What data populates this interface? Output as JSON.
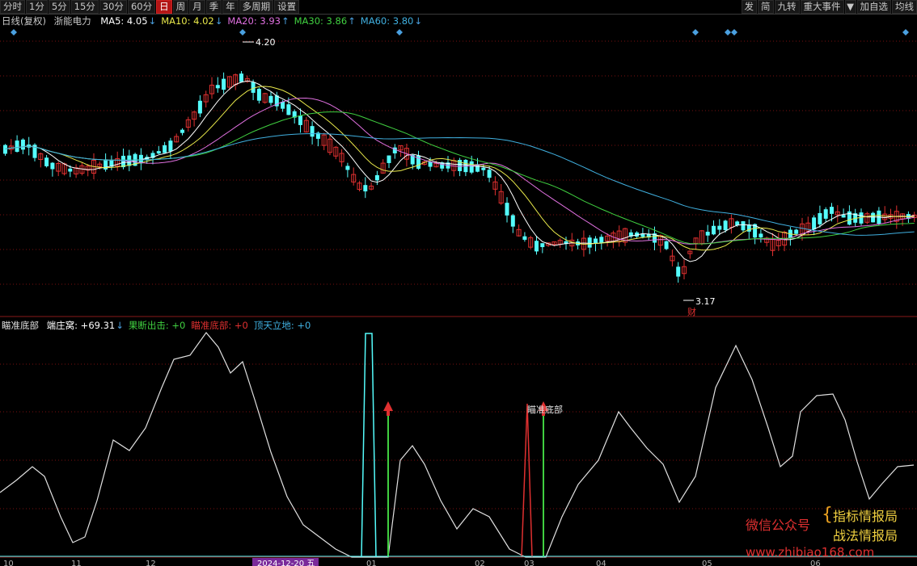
{
  "toolbar": {
    "left": [
      {
        "label": "分时",
        "active": false
      },
      {
        "label": "1分",
        "active": false
      },
      {
        "label": "5分",
        "active": false
      },
      {
        "label": "15分",
        "active": false
      },
      {
        "label": "30分",
        "active": false
      },
      {
        "label": "60分",
        "active": false
      },
      {
        "label": "日",
        "active": true
      },
      {
        "label": "周",
        "active": false
      },
      {
        "label": "月",
        "active": false
      },
      {
        "label": "季",
        "active": false
      },
      {
        "label": "年",
        "active": false
      },
      {
        "label": "多周期",
        "active": false
      },
      {
        "label": "设置",
        "active": false
      }
    ],
    "right": [
      "发",
      "简",
      "九转",
      "重大事件",
      "▼",
      "加自选",
      "均线"
    ]
  },
  "main_legend": {
    "period": "日线(复权)",
    "stock": "浙能电力",
    "ma": [
      {
        "label": "MA5: 4.05",
        "arrow": "↓",
        "color": "#ffffff"
      },
      {
        "label": "MA10: 4.02",
        "arrow": "↓",
        "color": "#e8e84a"
      },
      {
        "label": "MA20: 3.93",
        "arrow": "↑",
        "color": "#e070e0"
      },
      {
        "label": "MA30: 3.86",
        "arrow": "↑",
        "color": "#40d040"
      },
      {
        "label": "MA60: 3.80",
        "arrow": "↓",
        "color": "#40b0e0"
      }
    ]
  },
  "price_annotations": {
    "high": "4.20",
    "low": "3.17",
    "low_tag": "财"
  },
  "indicator_legend": {
    "name": "瞄准底部",
    "items": [
      {
        "label": "端庄窝: +69.31",
        "arrow": "↓",
        "color": "#ffffff"
      },
      {
        "label": "果断出击: +0",
        "arrow": "",
        "color": "#40d040"
      },
      {
        "label": "瞄准底部: +0",
        "arrow": "",
        "color": "#e03030"
      },
      {
        "label": "顶天立地: +0",
        "arrow": "",
        "color": "#40b0e0"
      }
    ],
    "signal_text": "瞄准底部"
  },
  "date_axis": [
    "10",
    "11",
    "12",
    "2024-12-20 五",
    "01",
    "02",
    "03",
    "04",
    "05",
    "06"
  ],
  "watermark": {
    "left": "微信公众号",
    "right_top": "指标情报局",
    "right_bottom": "战法情报局",
    "url": "www.zhibiao168.com"
  },
  "colors": {
    "up": "#e03030",
    "down": "#54fcfc",
    "background": "#000000",
    "grid": "#7a1010"
  }
}
